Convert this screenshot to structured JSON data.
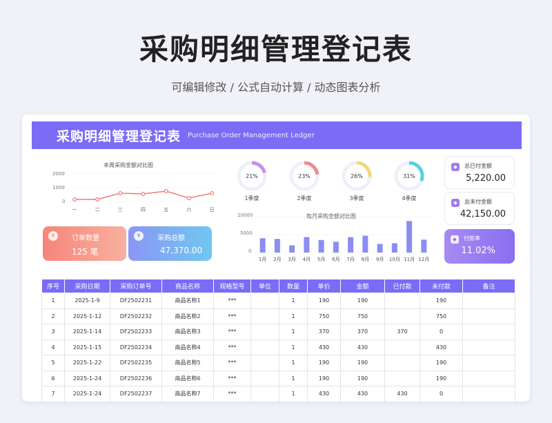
{
  "page": {
    "title": "采购明细管理登记表",
    "subtitle": "可编辑修改 / 公式自动计算 / 动态图表分析"
  },
  "banner": {
    "title_cn": "采购明细管理登记表",
    "title_en": "Purchase Order Management Ledger"
  },
  "weekly_chart": {
    "title": "本周采购金额对比图",
    "y_ticks": [
      "2000",
      "1000",
      "0"
    ],
    "x_ticks": [
      "一",
      "二",
      "三",
      "四",
      "五",
      "六",
      "日"
    ]
  },
  "kpis": {
    "order_count_label": "订单数量",
    "order_count_value": "125  笔",
    "order_icon": "¥",
    "total_label": "采购总额",
    "total_value": "47,370.00",
    "total_icon": "¥"
  },
  "quarters": [
    {
      "label": "1季度",
      "pct": "21%",
      "value": 0.21,
      "color": "#c98ef0"
    },
    {
      "label": "2季度",
      "pct": "23%",
      "value": 0.23,
      "color": "#f08c8c"
    },
    {
      "label": "3季度",
      "pct": "26%",
      "value": 0.26,
      "color": "#f5d77a"
    },
    {
      "label": "4季度",
      "pct": "31%",
      "value": 0.31,
      "color": "#55d3e0"
    }
  ],
  "monthly_chart": {
    "title": "每月采购金额对比图",
    "y_ticks": [
      "10000",
      "5000",
      "0"
    ],
    "months": [
      "1月",
      "2月",
      "3月",
      "4月",
      "5月",
      "6月",
      "7月",
      "8月",
      "9月",
      "10月",
      "11月",
      "12月"
    ]
  },
  "side": {
    "paid_label": "总已付金额",
    "paid_value": "5,220.00",
    "unpaid_label": "总未付金额",
    "unpaid_value": "42,150.00",
    "rate_label": "付款率",
    "rate_value": "11.02%"
  },
  "table": {
    "headers": [
      "序号",
      "采购日期",
      "采购订单号",
      "商品名称",
      "规格型号",
      "单位",
      "数量",
      "单价",
      "金额",
      "已付款",
      "未付款",
      "备注"
    ],
    "rows": [
      [
        "1",
        "2025-1-9",
        "DF2502231",
        "商品名称1",
        "***",
        "",
        "1",
        "190",
        "190",
        "",
        "190",
        ""
      ],
      [
        "2",
        "2025-1-12",
        "DF2502232",
        "商品名称2",
        "***",
        "",
        "1",
        "750",
        "750",
        "",
        "750",
        ""
      ],
      [
        "3",
        "2025-1-14",
        "DF2502233",
        "商品名称3",
        "***",
        "",
        "1",
        "370",
        "370",
        "370",
        "0",
        ""
      ],
      [
        "4",
        "2025-1-15",
        "DF2502234",
        "商品名称4",
        "***",
        "",
        "1",
        "430",
        "430",
        "",
        "430",
        ""
      ],
      [
        "5",
        "2025-1-22",
        "DF2502235",
        "商品名称5",
        "***",
        "",
        "1",
        "190",
        "190",
        "",
        "190",
        ""
      ],
      [
        "6",
        "2025-1-24",
        "DF2502236",
        "商品名称6",
        "***",
        "",
        "1",
        "190",
        "190",
        "",
        "190",
        ""
      ],
      [
        "7",
        "2025-1-24",
        "DF2502237",
        "商品名称7",
        "***",
        "",
        "1",
        "430",
        "430",
        "430",
        "0",
        ""
      ]
    ]
  },
  "chart_data": [
    {
      "type": "line",
      "title": "本周采购金额对比图",
      "categories": [
        "一",
        "二",
        "三",
        "四",
        "五",
        "六",
        "日"
      ],
      "values": [
        150,
        150,
        600,
        550,
        750,
        250,
        600
      ],
      "ylim": [
        0,
        2000
      ],
      "color": "#f07a7a"
    },
    {
      "type": "bar",
      "title": "每月采购金额对比图",
      "categories": [
        "1月",
        "2月",
        "3月",
        "4月",
        "5月",
        "6月",
        "7月",
        "8月",
        "9月",
        "10月",
        "11月",
        "12月"
      ],
      "values": [
        4000,
        3800,
        2000,
        4300,
        3500,
        3000,
        4300,
        4700,
        2400,
        2600,
        8800,
        3600
      ],
      "ylim": [
        0,
        10000
      ],
      "color": "#8a8ef2"
    }
  ]
}
